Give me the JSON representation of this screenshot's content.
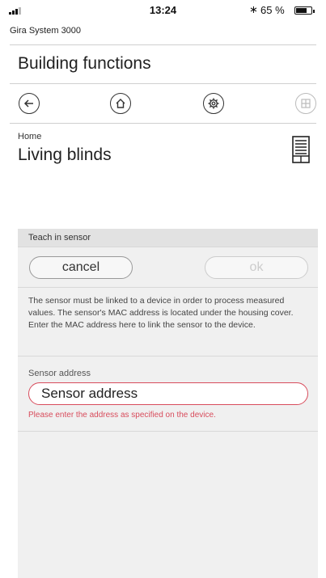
{
  "status_bar": {
    "time": "13:24",
    "battery": "65 %",
    "battery_level": 0.65,
    "bluetooth_icon": "bluetooth-icon"
  },
  "header": {
    "system_name": "Gira System 3000",
    "title": "Building functions"
  },
  "nav": {
    "icons": [
      "back-arrow-icon",
      "home-icon",
      "gear-icon",
      "grid-icon"
    ]
  },
  "room": {
    "breadcrumb": "Home",
    "title": "Living blinds",
    "icon": "blinds-icon"
  },
  "teach_panel": {
    "header": "Teach in sensor",
    "cancel_label": "cancel",
    "ok_label": "ok",
    "description": "The sensor must be linked to a device in order to process measured values. The sensor's MAC address is located under the housing cover. Enter the MAC address here to link the sensor to the device.",
    "field_label": "Sensor address",
    "field_placeholder": "Sensor address",
    "field_value": "",
    "error": "Please enter the address as specified on the device."
  },
  "colors": {
    "accent_error": "#d84c5c",
    "panel_bg": "#f0f0f0"
  }
}
